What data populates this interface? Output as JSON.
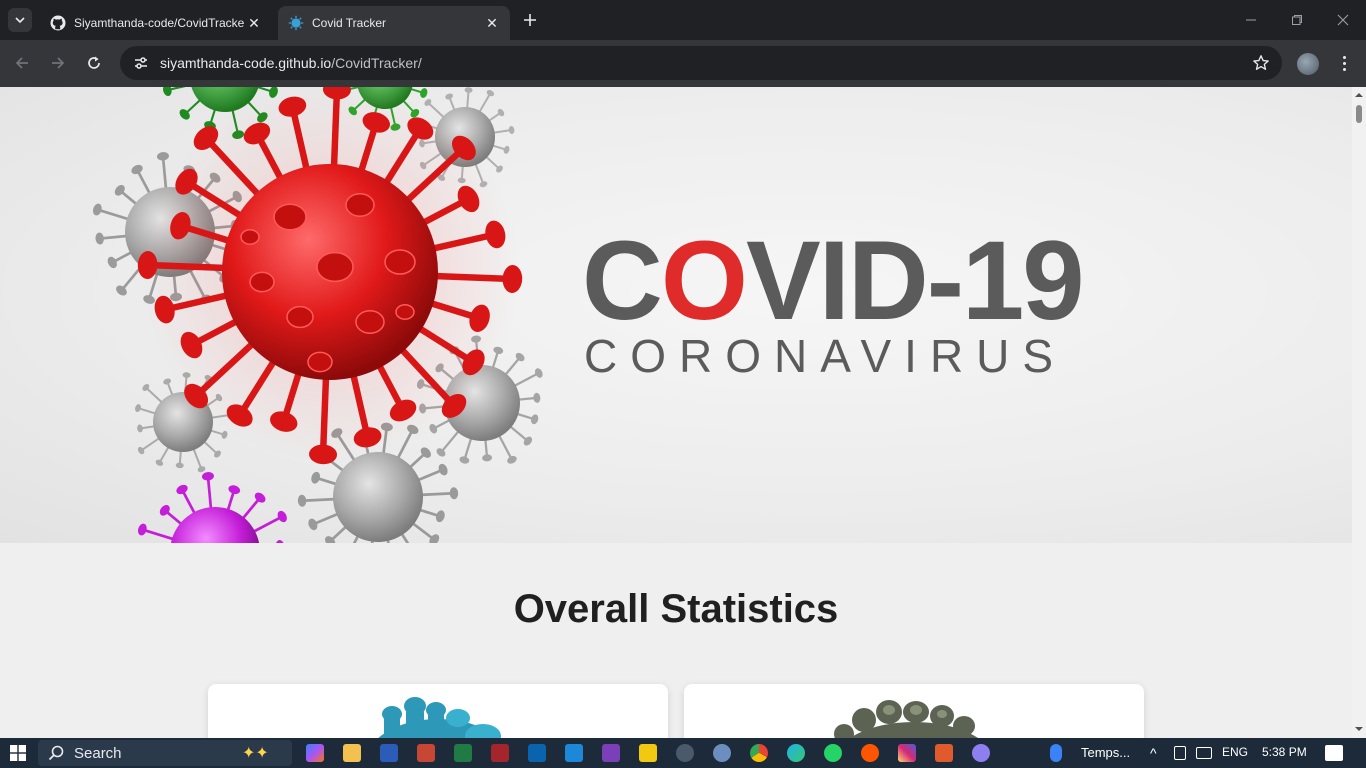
{
  "browser": {
    "tabs": [
      {
        "title": "Siyamthanda-code/CovidTracke",
        "favicon": "github-icon",
        "active": false
      },
      {
        "title": "Covid Tracker",
        "favicon": "virus-icon",
        "active": true
      }
    ],
    "address": {
      "host": "siyamthanda-code.github.io",
      "path": "/CovidTracker/"
    }
  },
  "page": {
    "hero": {
      "logo_main_prefix": "C",
      "logo_main_accent": "O",
      "logo_main_suffix": "VID-19",
      "logo_sub": "CORONAVIRUS"
    },
    "stats_title": "Overall Statistics"
  },
  "taskbar": {
    "search_label": "Search",
    "weather_label": "Temps...",
    "language": "ENG",
    "time": "5:38 PM"
  },
  "colors": {
    "accent": "#e02b2b",
    "logo_gray": "#5b5b5b",
    "page_bg": "#efefef"
  }
}
